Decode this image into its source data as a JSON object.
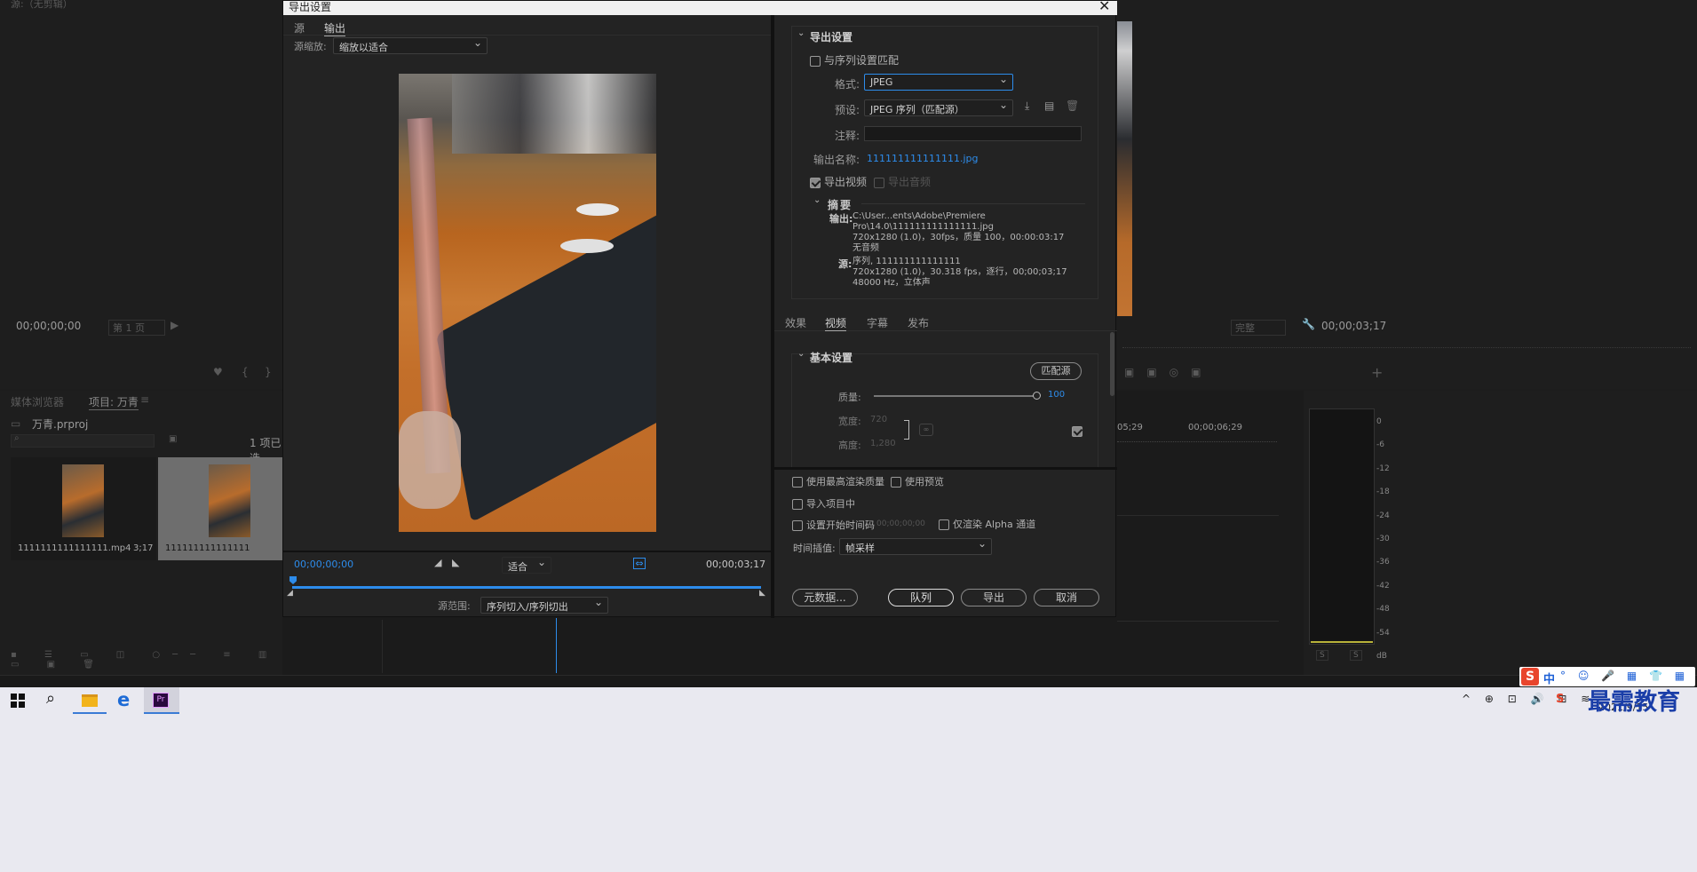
{
  "bg_panel": {
    "top_left_title": "源:（无剪辑）",
    "timecode_left": "00;00;00;00",
    "page_select": "第 1 页",
    "right_fit": "完整",
    "right_timecode": "00;00;03;17",
    "project_tabs": [
      "媒体浏览器",
      "项目: 万青"
    ],
    "project_file": "万青.prproj",
    "items_selected": "1 项已选",
    "clips": [
      {
        "name": "1111111111111111.mp4",
        "duration": "3;17"
      },
      {
        "name": "111111111111111",
        "duration": ""
      }
    ],
    "timeline_times": [
      "05;29",
      "00;00;06;29"
    ],
    "meter_labels": [
      "0",
      "-6",
      "-12",
      "-18",
      "-24",
      "-30",
      "-36",
      "-42",
      "-48",
      "-54",
      "dB"
    ],
    "meter_buttons": [
      "S",
      "S"
    ]
  },
  "dialog": {
    "title": "导出设置",
    "left_tabs": [
      "源",
      "输出"
    ],
    "source_scale_label": "源缩放:",
    "source_scale_value": "缩放以适合",
    "timecode_start": "00;00;00;00",
    "fit_value": "适合",
    "timecode_end": "00;00;03;17",
    "source_range_label": "源范围:",
    "source_range_value": "序列切入/序列切出",
    "export_settings": {
      "header": "导出设置",
      "match_sequence": "与序列设置匹配",
      "format_label": "格式:",
      "format_value": "JPEG",
      "preset_label": "预设:",
      "preset_value": "JPEG 序列（匹配源）",
      "comment_label": "注释:",
      "comment_value": "",
      "output_name_label": "输出名称:",
      "output_name_value": "111111111111111.jpg",
      "export_video": "导出视频",
      "export_audio": "导出音频",
      "summary_header": "摘要",
      "output_label": "输出:",
      "output_lines": [
        "C:\\User...ents\\Adobe\\Premiere Pro\\14.0\\111111111111111.jpg",
        "720x1280 (1.0)，30fps，质量 100，00:00:03:17",
        "无音频"
      ],
      "source_label": "源:",
      "source_lines": [
        "序列, 111111111111111",
        "720x1280 (1.0)，30.318 fps，逐行，00;00;03;17",
        "48000 Hz，立体声"
      ]
    },
    "right_tabs": [
      "效果",
      "视频",
      "字幕",
      "发布"
    ],
    "basic_settings": {
      "header": "基本设置",
      "match_source_btn": "匹配源",
      "quality_label": "质量:",
      "quality_value": "100",
      "quality_fraction": 1.0,
      "width_label": "宽度:",
      "width_value": "720",
      "height_label": "高度:",
      "height_value": "1,280"
    },
    "options": {
      "max_render": "使用最高渲染质量",
      "use_previews": "使用预览",
      "import_project": "导入项目中",
      "set_start_tc": "设置开始时间码",
      "start_tc_value": "00;00;00;00",
      "alpha_only": "仅渲染 Alpha 通道",
      "time_interp_label": "时间插值:",
      "time_interp_value": "帧采样"
    },
    "buttons": {
      "metadata": "元数据...",
      "queue": "队列",
      "export": "导出",
      "cancel": "取消"
    }
  },
  "taskbar": {
    "date": "2021/9/15",
    "ime": "中",
    "watermark": "最需教育"
  },
  "colors": {
    "accent_blue": "#2d8ceb",
    "premiere_purple": "#2a0a3e",
    "ime_red": "#e8452d"
  }
}
